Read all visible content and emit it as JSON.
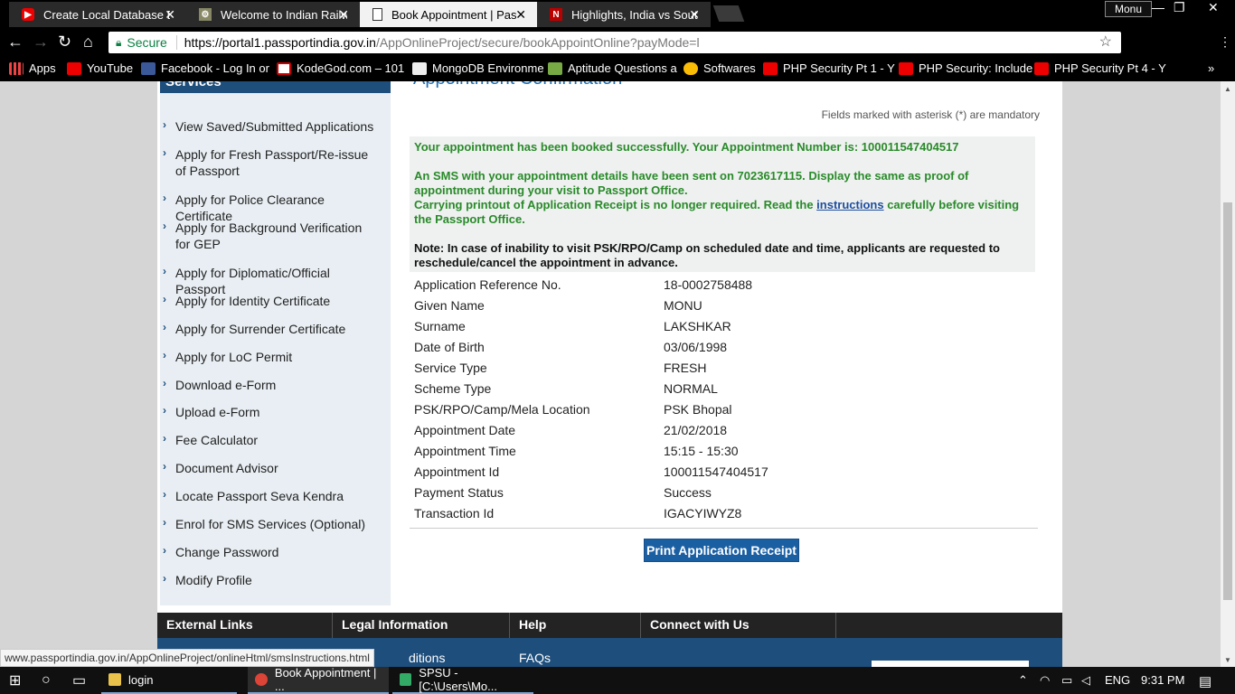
{
  "browser": {
    "tabs": [
      {
        "title": "Create Local Database Ea",
        "icon": "youtube-icon",
        "active": false
      },
      {
        "title": "Welcome to Indian Railw",
        "icon": "railway-icon",
        "active": false
      },
      {
        "title": "Book Appointment | Pas",
        "icon": "document-icon",
        "active": true
      },
      {
        "title": "Highlights, India vs South",
        "icon": "ndtv-icon",
        "active": false
      }
    ],
    "profile_name": "Monu",
    "secure_label": "Secure",
    "url_host": "https://portal1.passportindia.gov.in",
    "url_path": "/AppOnlineProject/secure/bookAppointOnline?payMode=l",
    "bookmarks": [
      {
        "label": "Apps",
        "icon": "apps-grid-icon"
      },
      {
        "label": "YouTube",
        "icon": "youtube-icon"
      },
      {
        "label": "Facebook - Log In or",
        "icon": "facebook-icon"
      },
      {
        "label": "KodeGod.com – 101",
        "icon": "kodegod-icon"
      },
      {
        "label": "MongoDB Environme",
        "icon": "mongodb-icon"
      },
      {
        "label": "Aptitude Questions a",
        "icon": "aptitude-icon"
      },
      {
        "label": "Softwares",
        "icon": "google-icon"
      },
      {
        "label": "PHP Security Pt 1 - Y",
        "icon": "youtube-icon"
      },
      {
        "label": "PHP Security: Include",
        "icon": "youtube-icon"
      },
      {
        "label": "PHP Security Pt 4 - Y",
        "icon": "youtube-icon"
      }
    ],
    "more_bookmarks": "»"
  },
  "sidebar": {
    "header": "Services",
    "items": [
      {
        "label": "View Saved/Submitted Applications"
      },
      {
        "label": "Apply for Fresh Passport/Re-issue of Passport"
      },
      {
        "label": "Apply for Police Clearance Certificate"
      },
      {
        "label": "Apply for Background Verification for GEP"
      },
      {
        "label": "Apply for Diplomatic/Official Passport"
      },
      {
        "label": "Apply for Identity Certificate"
      },
      {
        "label": "Apply for Surrender Certificate"
      },
      {
        "label": "Apply for LoC Permit"
      },
      {
        "label": "Download e-Form"
      },
      {
        "label": "Upload e-Form"
      },
      {
        "label": "Fee Calculator"
      },
      {
        "label": "Document Advisor"
      },
      {
        "label": "Locate Passport Seva Kendra"
      },
      {
        "label": "Enrol for SMS Services (Optional)"
      },
      {
        "label": "Change Password"
      },
      {
        "label": "Modify Profile"
      }
    ]
  },
  "main": {
    "title": "Appointment Confirmation",
    "mandatory_note": "Fields marked with asterisk (*) are mandatory",
    "success": {
      "line1": "Your appointment has been booked successfully. Your Appointment Number is: 100011547404517",
      "line2": "An SMS with your appointment details have been sent on 7023617115. Display the same as proof of appointment during your visit to Passport Office.",
      "line3_pre": "Carrying printout of Application Receipt is no longer required. Read the ",
      "line3_link": "instructions",
      "line3_post": " carefully before visiting the Passport Office.",
      "note": "Note: In case of inability to visit PSK/RPO/Camp on scheduled date and time, applicants are requested to reschedule/cancel the appointment in advance."
    },
    "details": [
      {
        "label": "Application Reference No.",
        "value": "18-0002758488"
      },
      {
        "label": "Given Name",
        "value": "MONU"
      },
      {
        "label": "Surname",
        "value": "LAKSHKAR"
      },
      {
        "label": "Date of Birth",
        "value": "03/06/1998"
      },
      {
        "label": "Service Type",
        "value": "FRESH"
      },
      {
        "label": "Scheme Type",
        "value": "NORMAL"
      },
      {
        "label": "PSK/RPO/Camp/Mela Location",
        "value": "PSK Bhopal"
      },
      {
        "label": "Appointment Date",
        "value": "21/02/2018"
      },
      {
        "label": "Appointment Time",
        "value": "15:15 - 15:30"
      },
      {
        "label": "Appointment Id",
        "value": "100011547404517"
      },
      {
        "label": "Payment Status",
        "value": "Success"
      },
      {
        "label": "Transaction Id",
        "value": "IGACYIWYZ8"
      }
    ],
    "print_button": "Print Application Receipt"
  },
  "footer": {
    "columns": [
      "External Links",
      "Legal Information",
      "Help",
      "Connect with Us"
    ],
    "links": [
      "ditions",
      "FAQs"
    ]
  },
  "status_url": "www.passportindia.gov.in/AppOnlineProject/onlineHtml/smsInstructions.html",
  "taskbar": {
    "apps": [
      {
        "label": "login",
        "icon": "folder-icon"
      },
      {
        "label": "Book Appointment | ...",
        "icon": "chrome-icon"
      },
      {
        "label": "SPSU - [C:\\Users\\Mo...",
        "icon": "dreamweaver-icon"
      }
    ],
    "language": "ENG",
    "time": "9:31 PM"
  }
}
